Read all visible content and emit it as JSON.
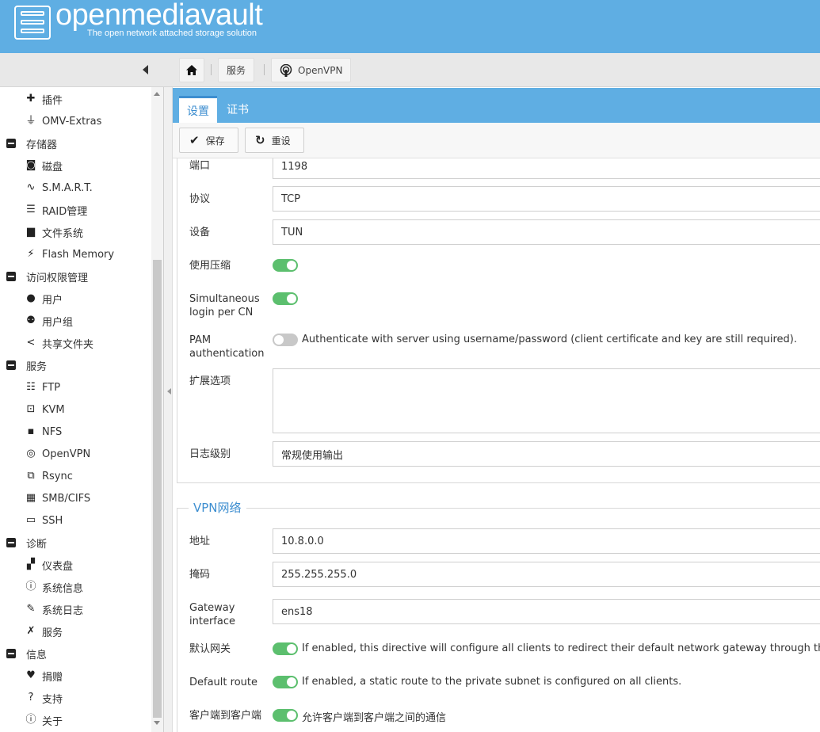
{
  "header": {
    "title": "openmediavault",
    "subtitle": "The open network attached storage solution"
  },
  "breadcrumb": {
    "items": [
      {
        "label": "服务"
      },
      {
        "label": "OpenVPN"
      }
    ]
  },
  "sidebar": {
    "entries": [
      {
        "type": "item",
        "label": "插件",
        "icon": "plugin-icon"
      },
      {
        "type": "item",
        "label": "OMV-Extras",
        "icon": "plug-icon"
      },
      {
        "type": "group",
        "label": "存储器"
      },
      {
        "type": "item",
        "label": "磁盘",
        "icon": "disk-icon"
      },
      {
        "type": "item",
        "label": "S.M.A.R.T.",
        "icon": "pulse-icon"
      },
      {
        "type": "item",
        "label": "RAID管理",
        "icon": "database-icon"
      },
      {
        "type": "item",
        "label": "文件系统",
        "icon": "folders-icon"
      },
      {
        "type": "item",
        "label": "Flash Memory",
        "icon": "flash-icon"
      },
      {
        "type": "group",
        "label": "访问权限管理"
      },
      {
        "type": "item",
        "label": "用户",
        "icon": "user-icon"
      },
      {
        "type": "item",
        "label": "用户组",
        "icon": "users-icon"
      },
      {
        "type": "item",
        "label": "共享文件夹",
        "icon": "share-icon"
      },
      {
        "type": "group",
        "label": "服务"
      },
      {
        "type": "item",
        "label": "FTP",
        "icon": "ftp-icon"
      },
      {
        "type": "item",
        "label": "KVM",
        "icon": "kvm-icon"
      },
      {
        "type": "item",
        "label": "NFS",
        "icon": "nfs-icon"
      },
      {
        "type": "item",
        "label": "OpenVPN",
        "icon": "openvpn-icon"
      },
      {
        "type": "item",
        "label": "Rsync",
        "icon": "rsync-icon"
      },
      {
        "type": "item",
        "label": "SMB/CIFS",
        "icon": "windows-icon"
      },
      {
        "type": "item",
        "label": "SSH",
        "icon": "terminal-icon"
      },
      {
        "type": "group",
        "label": "诊断"
      },
      {
        "type": "item",
        "label": "仪表盘",
        "icon": "dashboard-icon"
      },
      {
        "type": "item",
        "label": "系统信息",
        "icon": "info-icon"
      },
      {
        "type": "item",
        "label": "系统日志",
        "icon": "log-icon"
      },
      {
        "type": "item",
        "label": "服务",
        "icon": "wrench-icon"
      },
      {
        "type": "group",
        "label": "信息"
      },
      {
        "type": "item",
        "label": "捐赠",
        "icon": "heart-icon"
      },
      {
        "type": "item",
        "label": "支持",
        "icon": "question-icon"
      },
      {
        "type": "item",
        "label": "关于",
        "icon": "about-icon"
      }
    ]
  },
  "tabs": [
    {
      "label": "设置",
      "active": true
    },
    {
      "label": "证书",
      "active": false
    }
  ],
  "toolbar": {
    "save_label": "保存",
    "reset_label": "重设"
  },
  "form": {
    "port": {
      "label": "端口",
      "value": "1198"
    },
    "protocol": {
      "label": "协议",
      "value": "TCP"
    },
    "device": {
      "label": "设备",
      "value": "TUN"
    },
    "compression": {
      "label": "使用压缩",
      "enabled": true
    },
    "simultaneous": {
      "label": "Simultaneous login per CN",
      "enabled": true
    },
    "pam": {
      "label": "PAM authentication",
      "enabled": false,
      "desc": "Authenticate with server using username/password (client certificate and key are still required)."
    },
    "extra": {
      "label": "扩展选项",
      "value": ""
    },
    "loglevel": {
      "label": "日志级别",
      "value": "常规使用输出"
    }
  },
  "vpn_network": {
    "legend": "VPN网络",
    "address": {
      "label": "地址",
      "value": "10.8.0.0"
    },
    "mask": {
      "label": "掩码",
      "value": "255.255.255.0"
    },
    "gateway_interface": {
      "label": "Gateway interface",
      "value": "ens18"
    },
    "default_gateway": {
      "label": "默认网关",
      "enabled": true,
      "desc": "If enabled, this directive will configure all clients to redirect their default network gateway through the VPN."
    },
    "default_route": {
      "label": "Default route",
      "enabled": true,
      "desc": "If enabled, a static route to the private subnet is configured on all clients."
    },
    "client_to_client": {
      "label": "客户端到客户端",
      "enabled": true,
      "desc": "允许客户端到客户端之间的通信"
    }
  },
  "colors": {
    "header": "#5faee3",
    "accent": "#3d8ed0",
    "toggle_on": "#5cbf6e",
    "toggle_off": "#c8c8c8"
  }
}
